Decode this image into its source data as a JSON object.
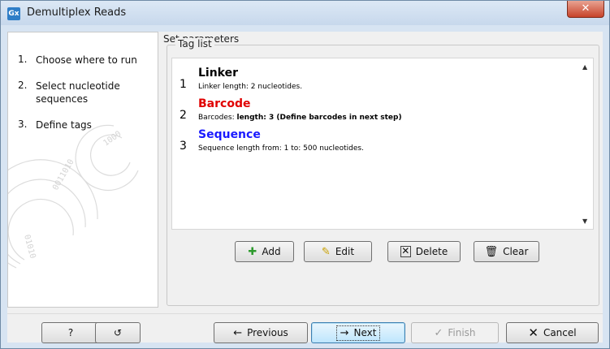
{
  "window": {
    "title": "Demultiplex Reads",
    "app_icon": "Gx",
    "close_icon": "✕"
  },
  "steps": [
    {
      "num": "1.",
      "label": "Choose where to run"
    },
    {
      "num": "2.",
      "label": "Select nucleotide sequences"
    },
    {
      "num": "3.",
      "label": "Define tags"
    }
  ],
  "panel": {
    "heading": "Set parameters",
    "group_label": "Tag list"
  },
  "tags": [
    {
      "idx": "1",
      "name": "Linker",
      "color": "#000000",
      "desc_prefix": "Linker length: 2 nucleotides.",
      "desc_bold": ""
    },
    {
      "idx": "2",
      "name": "Barcode",
      "color": "#e00000",
      "desc_prefix": "Barcodes: ",
      "desc_bold": "length: 3 (Define barcodes in next step)"
    },
    {
      "idx": "3",
      "name": "Sequence",
      "color": "#1a1aff",
      "desc_prefix": "Sequence length from: 1 to: 500 nucleotides.",
      "desc_bold": ""
    }
  ],
  "tag_buttons": {
    "add": "Add",
    "edit": "Edit",
    "delete": "Delete",
    "clear": "Clear"
  },
  "footer": {
    "help": "?",
    "reset": "↺",
    "previous": "Previous",
    "next": "Next",
    "finish": "Finish",
    "cancel": "Cancel"
  },
  "colors": {
    "add_icon": "#2e9a2e",
    "cancel_icon": "#000000"
  }
}
